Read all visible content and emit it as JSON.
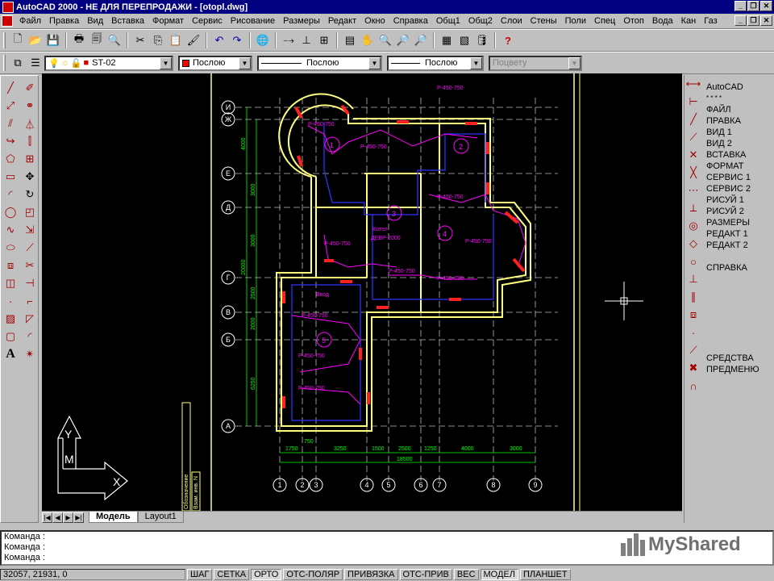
{
  "window": {
    "title": "AutoCAD 2000 - НЕ ДЛЯ ПЕРЕПРОДАЖИ - [otopl.dwg]"
  },
  "menu": [
    "Файл",
    "Правка",
    "Вид",
    "Вставка",
    "Формат",
    "Сервис",
    "Рисование",
    "Размеры",
    "Редакт",
    "Окно",
    "Справка",
    "Общ1",
    "Общ2",
    "Слои",
    "Стены",
    "Поли",
    "Спец",
    "Отоп",
    "Вода",
    "Кан",
    "Газ"
  ],
  "props_toolbar": {
    "layer": "ST-02",
    "color": "Послою",
    "linetype": "Послою",
    "lineweight": "Послою",
    "plotstyle": "Поцвету"
  },
  "right_menu": {
    "header": "AutoCAD",
    "stars": "* * * *",
    "items": [
      "ФАЙЛ",
      "ПРАВКА",
      "ВИД 1",
      "ВИД 2",
      "ВСТАВКА",
      "ФОРМАТ",
      "СЕРВИС 1",
      "СЕРВИС 2",
      "РИСУЙ 1",
      "РИСУЙ 2",
      "РАЗМЕРЫ",
      "РЕДАКТ 1",
      "РЕДАКТ 2"
    ],
    "help": "СПРАВКА",
    "tools_1": "СРЕДСТВА",
    "tools_2": "ПРЕДМЕНЮ"
  },
  "tabs": {
    "model": "Модель",
    "layout": "Layout1"
  },
  "command_lines": [
    "Команда :",
    "Команда :",
    "Команда :"
  ],
  "status": {
    "coords": "32057, 21931, 0",
    "buttons": [
      "ШАГ",
      "СЕТКА",
      "ОРТО",
      "ОТС-ПОЛЯР",
      "ПРИВЯЗКА",
      "ОТС-ПРИВ",
      "ВЕС",
      "МОДЕЛ",
      "ПЛАНШЕТ"
    ],
    "pressed": [
      "ОРТО",
      "МОДЕЛ"
    ]
  },
  "plan": {
    "row_axes": [
      "И",
      "Ж",
      "Е",
      "Д",
      "Г",
      "В",
      "Б",
      "А"
    ],
    "col_axes": [
      "1",
      "2",
      "3",
      "4",
      "5",
      "6",
      "7",
      "8",
      "9"
    ],
    "rooms": [
      "1",
      "2",
      "3",
      "4",
      "5"
    ],
    "dims_bottom": [
      "1750",
      "3250",
      "1500",
      "2500",
      "1250",
      "4000",
      "3000"
    ],
    "dim_total": "18500",
    "dim_750": "750",
    "dims_left": [
      "4000",
      "3000",
      "3000",
      "2500",
      "2000",
      "6250"
    ],
    "dim_left_total": "20000",
    "pipe_label": "Р-450-750",
    "boiler": [
      "Котел",
      "ДЕВР-2000"
    ],
    "vvod": "Ввод",
    "stamp_1": "Обозначение",
    "stamp_2": "Взам. инв. N",
    "ucs": [
      "Y",
      "M",
      "X"
    ]
  },
  "watermark": "MyShared",
  "colors": {
    "titlebar": "#000080",
    "canvas": "#000000",
    "wall": "#ffff80",
    "pipe": "#ff00ff",
    "pipe_blue": "#3030ff",
    "radiator": "#ff2020",
    "dim": "#00ff00",
    "axis": "#ffffff"
  }
}
